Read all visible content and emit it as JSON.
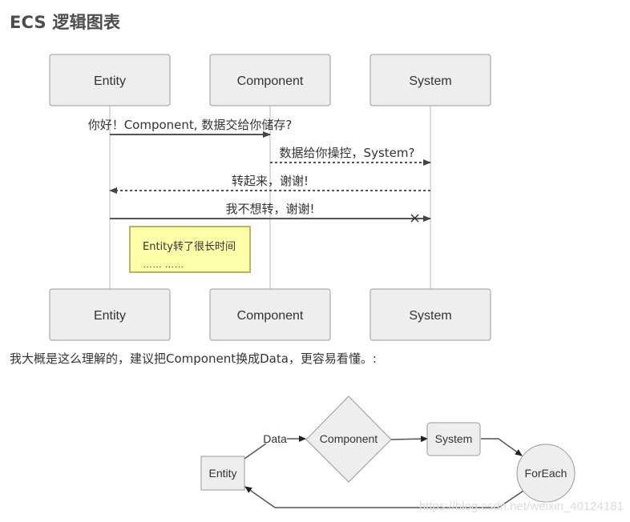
{
  "heading": "ECS 逻辑图表",
  "sequence": {
    "actors": [
      "Entity",
      "Component",
      "System"
    ],
    "messages": [
      {
        "from": "Entity",
        "to": "Component",
        "label": "你好！Component, 数据交给你储存?",
        "style": "solid"
      },
      {
        "from": "Component",
        "to": "System",
        "label": "数据给你操控，System?",
        "style": "dashed"
      },
      {
        "from": "System",
        "to": "Entity",
        "label": "转起来，谢谢!",
        "style": "dashed"
      },
      {
        "from": "Entity",
        "to": "System",
        "label": "我不想转，谢谢!",
        "style": "cross"
      }
    ],
    "note": {
      "line1": "Entity转了很长时间",
      "line2": "…… ……"
    }
  },
  "paragraph": "我大概是这么理解的，建议把Component换成Data，更容易看懂。:",
  "flowchart": {
    "nodes": {
      "entity": "Entity",
      "component": "Component",
      "system": "System",
      "foreach": "ForEach"
    },
    "edge_label": "Data"
  },
  "watermark": "https://blog.csdn.net/weixin_40124181",
  "colors": {
    "box_fill": "#eeeeee",
    "box_stroke": "#999999",
    "note_fill": "#ffffaa",
    "note_stroke": "#b5b562",
    "line": "#555555",
    "lifeline": "#dddddd"
  }
}
